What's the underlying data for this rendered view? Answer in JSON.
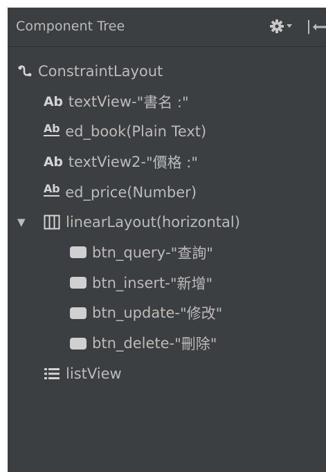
{
  "header": {
    "title": "Component Tree"
  },
  "tree": {
    "root": {
      "name": "ConstraintLayout",
      "icon": "constraint-layout-icon"
    },
    "items": [
      {
        "name": "textView",
        "separator": "- ",
        "desc": "\"書名 :\"",
        "icon": "text-view-icon",
        "icon_text": "Ab"
      },
      {
        "name": "ed_book",
        "separator": "",
        "desc": "(Plain Text)",
        "icon": "edit-text-icon",
        "icon_text": "Ab"
      },
      {
        "name": "textView2",
        "separator": "- ",
        "desc": "\"價格 :\"",
        "icon": "text-view-icon",
        "icon_text": "Ab"
      },
      {
        "name": "ed_price",
        "separator": "",
        "desc": "(Number)",
        "icon": "edit-text-icon",
        "icon_text": "Ab"
      },
      {
        "name": "linearLayout",
        "separator": "",
        "desc": "(horizontal)",
        "icon": "linear-layout-icon",
        "expanded_symbol": "▼"
      },
      {
        "name": "btn_query",
        "separator": "- ",
        "desc": "\"查詢\"",
        "icon": "button-icon"
      },
      {
        "name": "btn_insert",
        "separator": "- ",
        "desc": "\"新增\"",
        "icon": "button-icon"
      },
      {
        "name": "btn_update",
        "separator": "- ",
        "desc": "\"修改\"",
        "icon": "button-icon"
      },
      {
        "name": "btn_delete",
        "separator": "- ",
        "desc": "\"刪除\"",
        "icon": "button-icon"
      },
      {
        "name": "listView",
        "separator": "",
        "desc": "",
        "icon": "list-view-icon"
      }
    ]
  },
  "colors": {
    "panel_bg": "#3c3f41",
    "text": "#bbbbbb",
    "icon": "#d4d4d4"
  }
}
